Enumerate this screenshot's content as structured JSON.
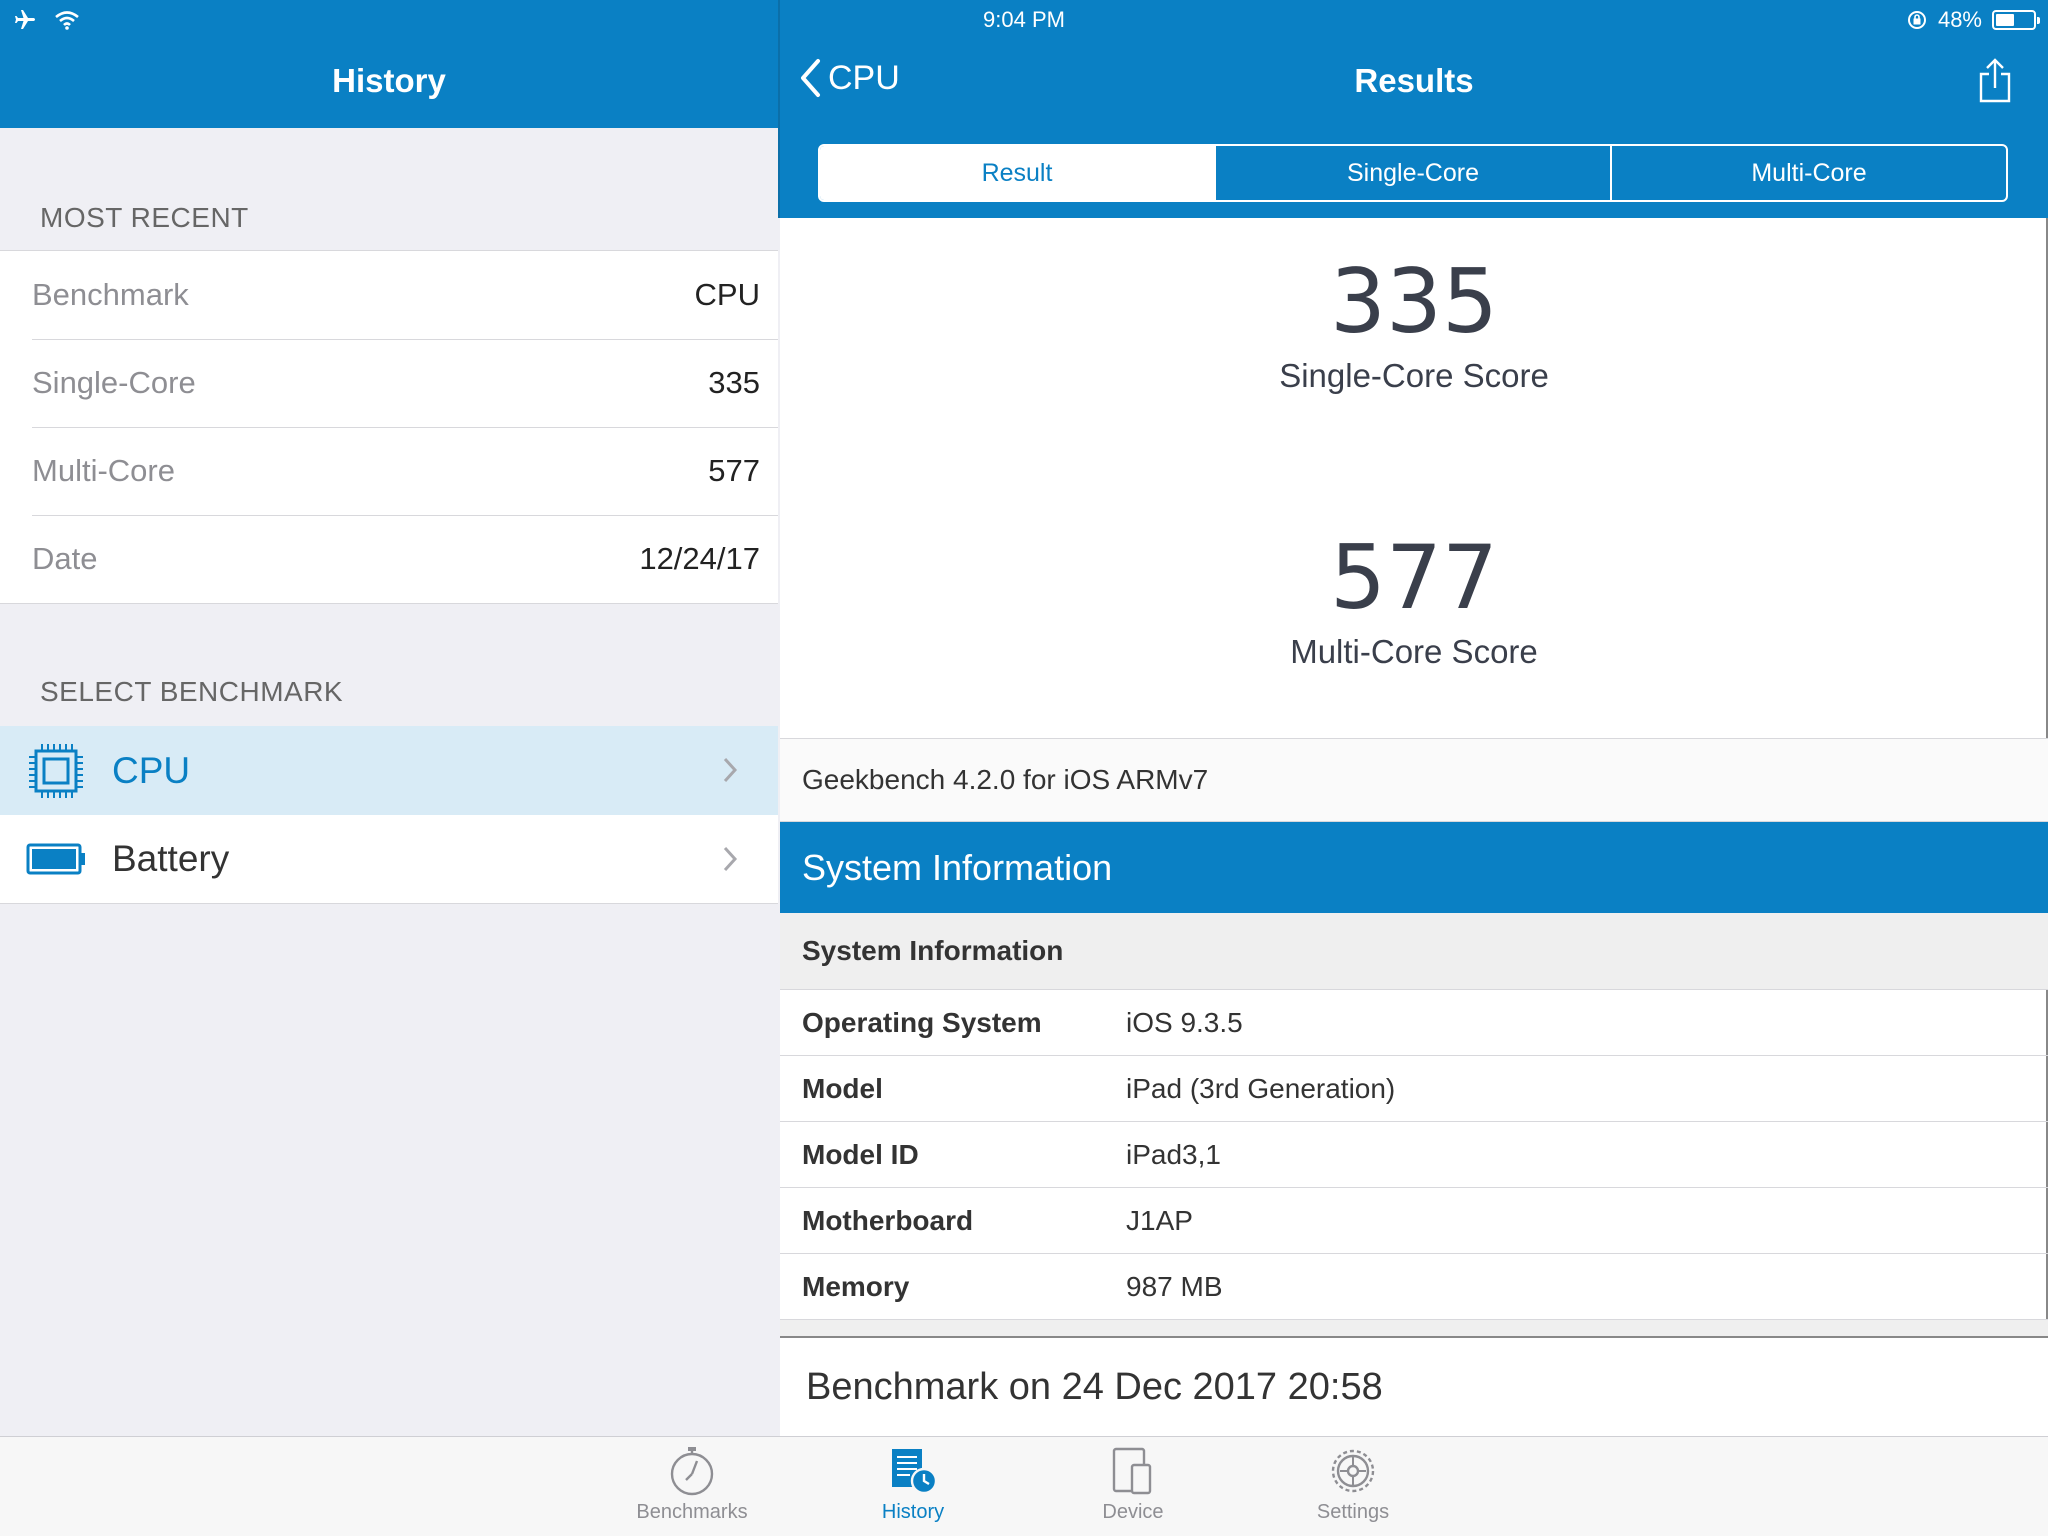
{
  "status_bar": {
    "time": "9:04 PM",
    "battery": "48%",
    "battery_level": 0.48,
    "icons": [
      "airplane-icon",
      "wifi-icon",
      "orientation-lock-icon",
      "battery-icon"
    ]
  },
  "left_panel": {
    "title": "History",
    "most_recent_header": "MOST RECENT",
    "rows": [
      {
        "key": "Benchmark",
        "value": "CPU"
      },
      {
        "key": "Single-Core",
        "value": "335"
      },
      {
        "key": "Multi-Core",
        "value": "577"
      },
      {
        "key": "Date",
        "value": "12/24/17"
      }
    ],
    "select_header": "SELECT BENCHMARK",
    "benchmarks": [
      {
        "label": "CPU",
        "icon": "cpu-chip-icon",
        "selected": true
      },
      {
        "label": "Battery",
        "icon": "battery-icon",
        "selected": false
      }
    ]
  },
  "right_panel": {
    "back_label": "CPU",
    "title": "Results",
    "tabs": [
      "Result",
      "Single-Core",
      "Multi-Core"
    ],
    "single_core_score": "335",
    "single_core_label": "Single-Core Score",
    "multi_core_score": "577",
    "multi_core_label": "Multi-Core Score",
    "version": "Geekbench 4.2.0 for iOS ARMv7",
    "section_title": "System Information",
    "subsection_title": "System Information",
    "system_info": [
      {
        "key": "Operating System",
        "value": "iOS 9.3.5"
      },
      {
        "key": "Model",
        "value": "iPad (3rd Generation)"
      },
      {
        "key": "Model ID",
        "value": "iPad3,1"
      },
      {
        "key": "Motherboard",
        "value": "J1AP"
      },
      {
        "key": "Memory",
        "value": "987 MB"
      }
    ],
    "benchmark_date": "Benchmark on 24 Dec 2017 20:58"
  },
  "tab_bar": {
    "items": [
      {
        "label": "Benchmarks",
        "icon": "stopwatch-icon",
        "active": false
      },
      {
        "label": "History",
        "icon": "history-icon",
        "active": true
      },
      {
        "label": "Device",
        "icon": "device-icon",
        "active": false
      },
      {
        "label": "Settings",
        "icon": "gear-icon",
        "active": false
      }
    ]
  },
  "colors": {
    "accent": "#0a80c4",
    "selected_row": "#d8ebf6",
    "background": "#efeff4"
  }
}
